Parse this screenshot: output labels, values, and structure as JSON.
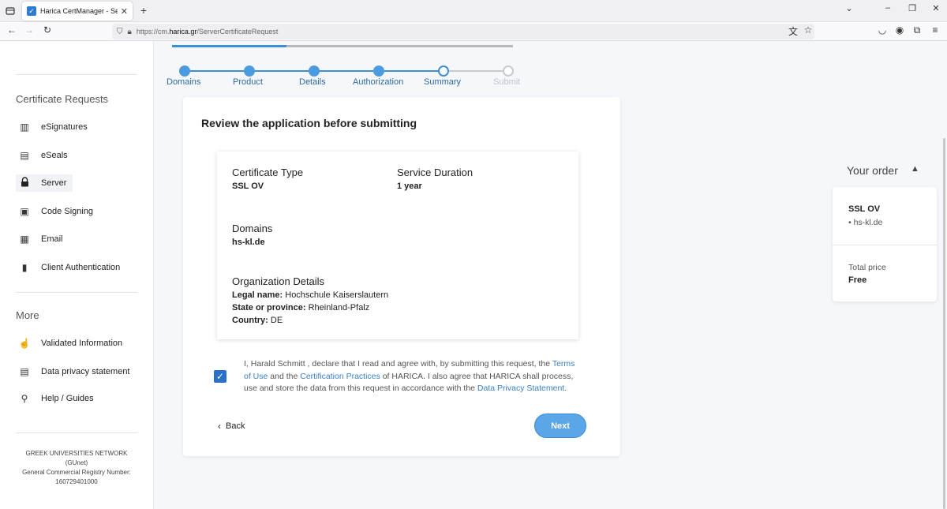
{
  "browser": {
    "tab_title": "Harica CertManager - Server Ce",
    "url_prefix": "https://cm.",
    "url_domain": "harica.gr",
    "url_path": "/ServerCertificateRequest"
  },
  "sidebar": {
    "section_certificate_requests": "Certificate Requests",
    "items": [
      {
        "label": "eSignatures",
        "icon": "signature-icon"
      },
      {
        "label": "eSeals",
        "icon": "seal-icon"
      },
      {
        "label": "Server",
        "icon": "lock-icon"
      },
      {
        "label": "Code Signing",
        "icon": "code-icon"
      },
      {
        "label": "Email",
        "icon": "email-icon"
      },
      {
        "label": "Client Authentication",
        "icon": "badge-icon"
      }
    ],
    "section_more": "More",
    "more_items": [
      {
        "label": "Validated Information",
        "icon": "hand-icon"
      },
      {
        "label": "Data privacy statement",
        "icon": "document-icon"
      },
      {
        "label": "Help / Guides",
        "icon": "help-icon"
      }
    ],
    "footer": {
      "line1": "GREEK UNIVERSITIES NETWORK",
      "line2": "(GUnet)",
      "line3": "General Commercial Registry Number:",
      "line4": "160729401000"
    }
  },
  "stepper": {
    "steps": [
      {
        "label": "Domains",
        "state": "done"
      },
      {
        "label": "Product",
        "state": "done"
      },
      {
        "label": "Details",
        "state": "done"
      },
      {
        "label": "Authorization",
        "state": "done"
      },
      {
        "label": "Summary",
        "state": "current"
      },
      {
        "label": "Submit",
        "state": "todo"
      }
    ],
    "accent": "#3d8ed3"
  },
  "main": {
    "title": "Review the application before submitting",
    "certificate_type_label": "Certificate Type",
    "certificate_type_value": "SSL OV",
    "service_duration_label": "Service Duration",
    "service_duration_value": "1 year",
    "domains_label": "Domains",
    "domains_value": "hs-kl.de",
    "org_details_label": "Organization Details",
    "legal_name_label": "Legal name:",
    "legal_name_value": "Hochschule Kaiserslautern",
    "state_label": "State or province:",
    "state_value": "Rheinland-Pfalz",
    "country_label": "Country:",
    "country_value": "DE",
    "agree_checked": true,
    "declaration_part1": "I, Harald Schmitt , declare that I read and agree with, by submitting this request, the ",
    "terms_link": "Terms of Use",
    "declaration_part2": " and the ",
    "cert_practices_link": "Certification Practices",
    "declaration_part3": " of HARICA. I also agree that HARICA shall process, use and store the data from this request in accordance with the ",
    "privacy_link": "Data Privacy Statement",
    "declaration_part4": ".",
    "back_label": "Back",
    "next_label": "Next"
  },
  "order": {
    "title": "Your order",
    "product": "SSL OV",
    "domain": "• hs-kl.de",
    "total_label": "Total price",
    "total_value": "Free"
  }
}
